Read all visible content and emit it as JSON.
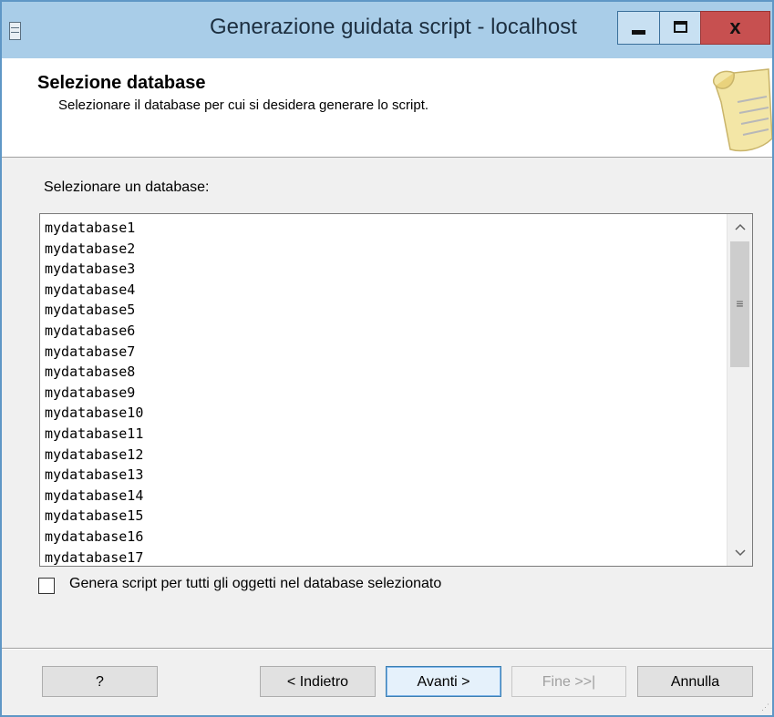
{
  "window": {
    "title": "Generazione guidata script - localhost",
    "close_glyph": "x",
    "icon": "document-icon",
    "controls": [
      "minimize-icon",
      "maximize-icon",
      "close-icon"
    ]
  },
  "header": {
    "title": "Selezione database",
    "subtitle": "Selezionare il database per cui si desidera generare lo script.",
    "art_icon": "scroll-icon"
  },
  "main": {
    "list_label": "Selezionare un database:",
    "databases": [
      "mydatabase1",
      "mydatabase2",
      "mydatabase3",
      "mydatabase4",
      "mydatabase5",
      "mydatabase6",
      "mydatabase7",
      "mydatabase8",
      "mydatabase9",
      "mydatabase10",
      "mydatabase11",
      "mydatabase12",
      "mydatabase13",
      "mydatabase14",
      "mydatabase15",
      "mydatabase16",
      "mydatabase17"
    ],
    "checkbox": {
      "label": "Genera script per tutti gli oggetti nel database selezionato",
      "checked": false
    }
  },
  "buttons": {
    "help": "?",
    "back": "< Indietro",
    "next": "Avanti >",
    "finish": "Fine >>|",
    "cancel": "Annulla"
  },
  "colors": {
    "titlebar": "#a9cde8",
    "window_border": "#5f97c6",
    "close_button": "#c75050",
    "dialog_bg": "#f0f0f0",
    "default_button_border": "#3c7fb1"
  }
}
